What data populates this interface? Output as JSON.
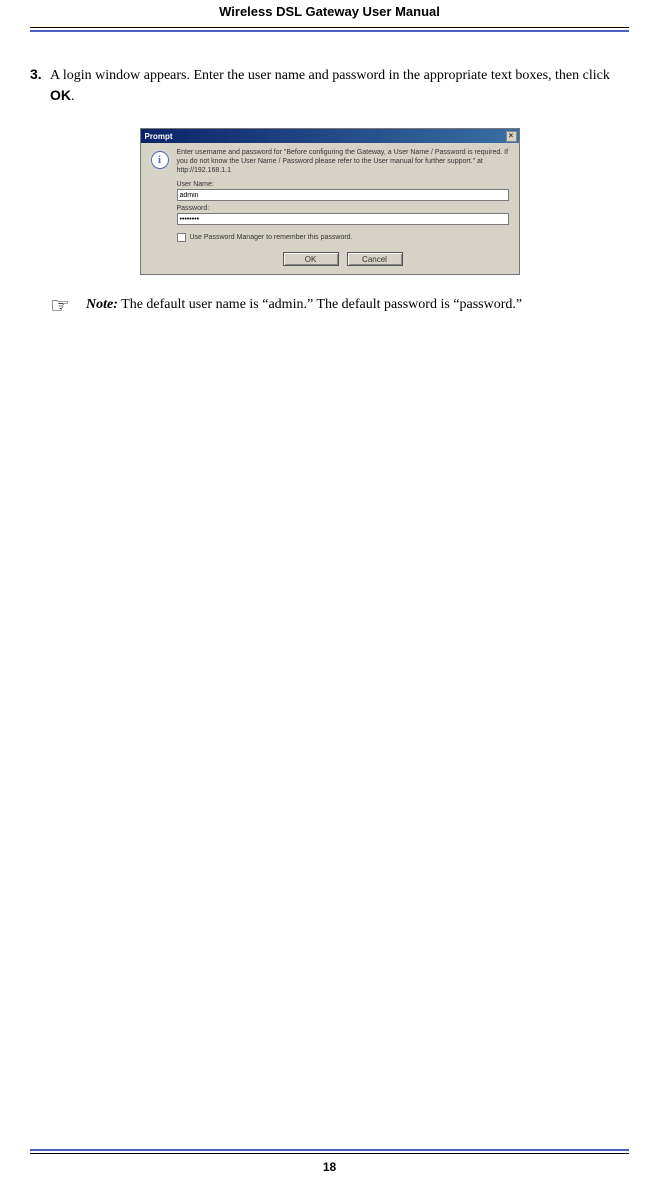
{
  "header": {
    "title": "Wireless DSL Gateway User Manual"
  },
  "step": {
    "number": "3.",
    "text_a": "A login window appears. Enter the user name and password in the appropriate text boxes, then click ",
    "ok": "OK",
    "text_b": "."
  },
  "dialog": {
    "title": "Prompt",
    "close": "×",
    "info": "i",
    "message": "Enter username and password for \"Before configuring the Gateway, a User Name / Password is required. If you do not know the User Name / Password please refer to the User manual for further support.\" at http://192.168.1.1",
    "username_label": "User Name:",
    "username_value": "admin",
    "password_label": "Password:",
    "password_value": "••••••••",
    "checkbox_label": "Use Password Manager to remember this password.",
    "ok_btn": "OK",
    "cancel_btn": "Cancel"
  },
  "note": {
    "icon": "☞",
    "label": "Note:",
    "text": " The default user name is “admin.” The default password is “password.”"
  },
  "footer": {
    "page": "18"
  }
}
